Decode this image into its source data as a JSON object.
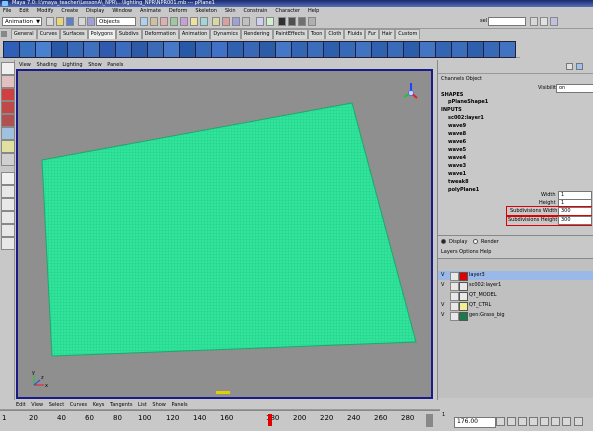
{
  "window": {
    "title": "Maya 7.0: I:\\maya_teacher\\LessonA\\_NPR\\...\\lighting_NPR\\NPR001.mb  ---  pPlane1"
  },
  "menubar": [
    "File",
    "Edit",
    "Modify",
    "Create",
    "Display",
    "Window",
    "Animate",
    "Deform",
    "Skeleton",
    "Skin",
    "Constrain",
    "Character",
    "Help"
  ],
  "statusline": {
    "mode": "Animation",
    "selection_field": "Objects",
    "sel_label": "sel"
  },
  "shelf": {
    "tabs": [
      "General",
      "Curves",
      "Surfaces",
      "Polygons",
      "Subdivs",
      "Deformation",
      "Animation",
      "Dynamics",
      "Rendering",
      "PaintEffects",
      "Toon",
      "Cloth",
      "Fluids",
      "Fur",
      "Hair",
      "Custom"
    ],
    "active_tab": "Polygons"
  },
  "panel_menu": [
    "View",
    "Shading",
    "Lighting",
    "Show",
    "Panels"
  ],
  "viewport": {
    "axis_x": "x",
    "axis_y": "y",
    "axis_z": "z",
    "plane_color": "#30e49c",
    "background": "#8f8f8f"
  },
  "channel_box": {
    "menu": [
      "Channels",
      "Object"
    ],
    "visibility_label": "Visibility",
    "visibility_value": "on",
    "shapes_header": "SHAPES",
    "shape_name": "pPlaneShape1",
    "inputs_header": "INPUTS",
    "inputs": [
      "sc002:layer1",
      "wave9",
      "wave8",
      "wave6",
      "wave5",
      "wave4",
      "wave3",
      "wave1",
      "tweak8",
      "polyPlane1"
    ],
    "fields": [
      {
        "label": "Width",
        "value": "1"
      },
      {
        "label": "Height",
        "value": "1"
      },
      {
        "label": "Subdivisions Width",
        "value": "300"
      },
      {
        "label": "Subdivisions Height",
        "value": "300"
      }
    ]
  },
  "display_render": {
    "display": "Display",
    "render": "Render"
  },
  "layer_menu": [
    "Layers",
    "Options",
    "Help"
  ],
  "layers": [
    {
      "v": "V",
      "name": "layer3",
      "color": "#e00000",
      "selected": true
    },
    {
      "v": "V",
      "name": "sc002:layer1",
      "color": "#e8e8e8",
      "selected": false
    },
    {
      "v": "",
      "name": "QT_MODEL",
      "color": "#e8e8e8",
      "selected": false
    },
    {
      "v": "V",
      "name": "QT_CTRL",
      "color": "#f0f090",
      "selected": false
    },
    {
      "v": "V",
      "name": "gen:Grass_big",
      "color": "#1a7a4a",
      "selected": false
    }
  ],
  "bottom_menu": [
    "Edit",
    "View",
    "Select",
    "Curves",
    "Keys",
    "Tangents",
    "List",
    "Show",
    "Panels"
  ],
  "timeline": {
    "ticks": [
      "1",
      "20",
      "40",
      "60",
      "80",
      "100",
      "120",
      "140",
      "160",
      "180",
      "200",
      "220",
      "240",
      "260",
      "280"
    ],
    "current_frame": "176.00",
    "start_frame": "1"
  }
}
